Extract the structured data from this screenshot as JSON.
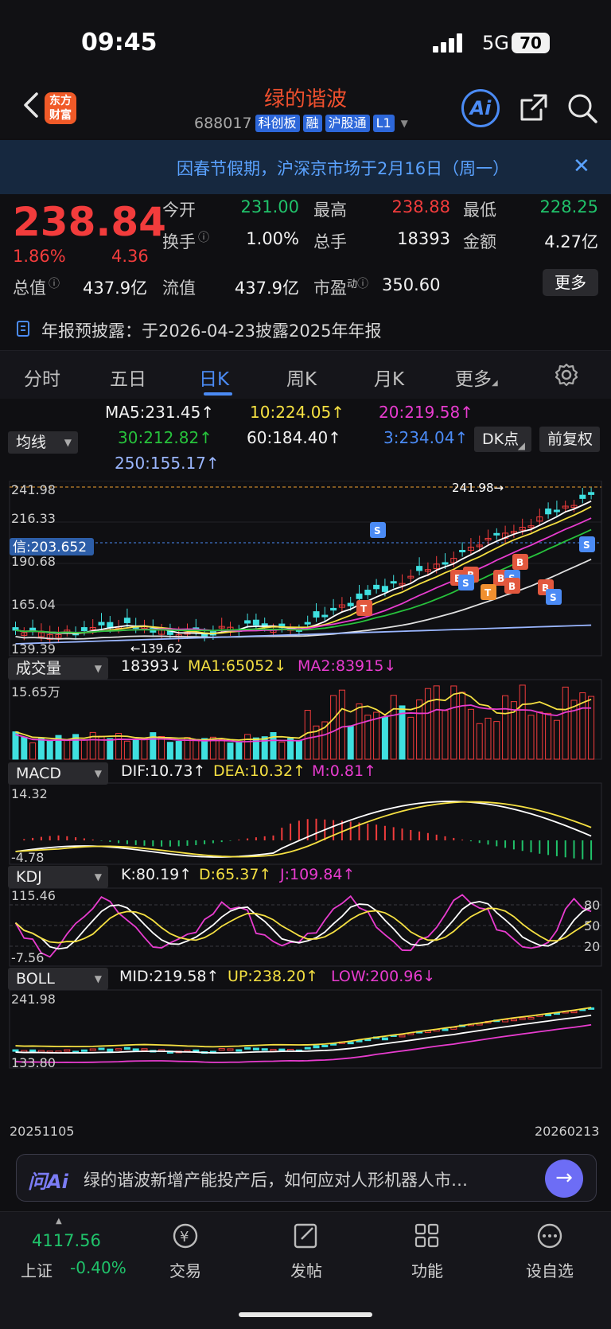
{
  "status_bar": {
    "time": "09:45",
    "network": "5G",
    "battery": "70"
  },
  "header": {
    "stock_name": "绿的谐波",
    "code": "688017",
    "tags": [
      "科创板",
      "融",
      "沪股通",
      "L1"
    ],
    "logo_text_1": "东方",
    "logo_text_2": "财富",
    "ai_label": "Ai"
  },
  "notice": {
    "text": "因春节假期，沪深京市场于2月16日（周一）"
  },
  "quote": {
    "price": "238.84",
    "change_pct": "1.86%",
    "change": "4.36",
    "open_label": "今开",
    "open": "231.00",
    "high_label": "最高",
    "high": "238.88",
    "low_label": "最低",
    "low": "228.25",
    "turnover_label": "换手",
    "turnover": "1.00%",
    "volume_label": "总手",
    "volume": "18393",
    "amount_label": "金额",
    "amount": "4.27亿",
    "mcap_label": "总值",
    "mcap": "437.9亿",
    "float_label": "流值",
    "float": "437.9亿",
    "pe_label": "市盈",
    "pe_sup": "动",
    "pe": "350.60",
    "more": "更多"
  },
  "announcement": {
    "text": "年报预披露：于2026-04-23披露2025年年报"
  },
  "tabs": [
    "分时",
    "五日",
    "日K",
    "周K",
    "月K",
    "更多"
  ],
  "ma_legend": {
    "ma5": "MA5:231.45↑",
    "ma10": "10:224.05↑",
    "ma20": "20:219.58↑",
    "ma30": "30:212.82↑",
    "ma60": "60:184.40↑",
    "ma3": "3:234.04↑",
    "ma250": "250:155.17↑",
    "selector": "均线",
    "dk": "DK点",
    "adjust": "前复权"
  },
  "kline": {
    "axis_top": "241.98",
    "axis_mid1": "216.33",
    "axis_mid2": "190.68",
    "axis_mid3": "165.04",
    "axis_bottom": "139.39",
    "max_marker": "241.98",
    "min_marker": "139.62",
    "signal_label": "信:203.652"
  },
  "volume": {
    "selector": "成交量",
    "v": "18393↓",
    "ma1": "MA1:65052↓",
    "ma2": "MA2:83915↓",
    "axis_top": "15.65万"
  },
  "macd": {
    "selector": "MACD",
    "dif": "DIF:10.73↑",
    "dea": "DEA:10.32↑",
    "m": "M:0.81↑",
    "axis_top": "14.32",
    "axis_bottom": "-4.78"
  },
  "kdj": {
    "selector": "KDJ",
    "k": "K:80.19↑",
    "d": "D:65.37↑",
    "j": "J:109.84↑",
    "axis_top": "115.46",
    "axis_bottom": "-7.56",
    "level_80": "80",
    "level_50": "50",
    "level_20": "20"
  },
  "boll": {
    "selector": "BOLL",
    "mid": "MID:219.58↑",
    "up": "UP:238.20↑",
    "low": "LOW:200.96↓",
    "axis_top": "241.98",
    "axis_bottom": "133.80"
  },
  "dates": {
    "start": "20251105",
    "end": "20260213"
  },
  "ask_ai": {
    "logo": "问Ai",
    "text": "绿的谐波新增产能投产后，如何应对人形机器人市…"
  },
  "bottom_nav": {
    "index_value": "4117.56",
    "index_name": "上证",
    "index_pct": "-0.40%",
    "items": [
      "交易",
      "发帖",
      "功能",
      "设自选"
    ]
  },
  "colors": {
    "up": "#f23c3c",
    "down": "#20c26a",
    "accent": "#4b8bf5",
    "ma5": "#ffffff",
    "ma10": "#f5e042",
    "ma20": "#e83ccf",
    "ma30": "#27c23c",
    "ma60": "#e0e0e0",
    "ma3": "#4b8bf5",
    "ma250": "#9ab6ff",
    "candle_down": "#3fe0e0"
  }
}
